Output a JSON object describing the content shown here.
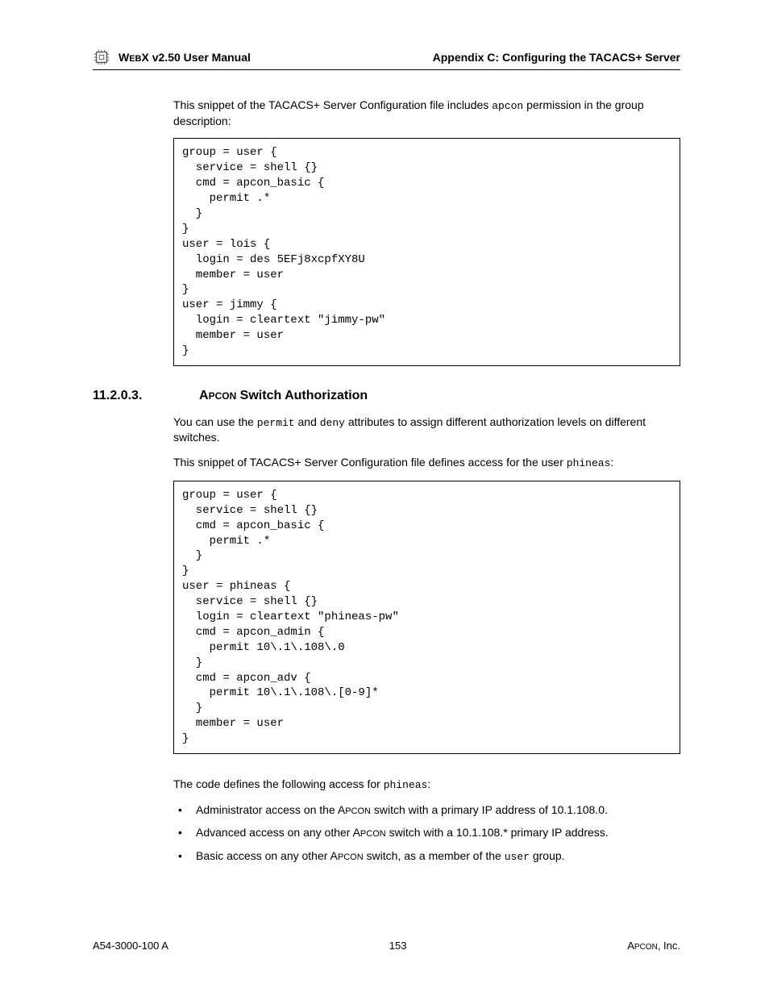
{
  "header": {
    "left_prefix": "W",
    "left_smallcaps": "EB",
    "left_rest": "X v2.50 User Manual",
    "right": "Appendix C: Configuring the TACACS+ Server"
  },
  "intro_para_pre": "This snippet of the TACACS+ Server Configuration file includes ",
  "intro_para_code": "apcon",
  "intro_para_post": " permission in the group description:",
  "code1": "group = user {\n  service = shell {}\n  cmd = apcon_basic {\n    permit .*\n  }\n}\nuser = lois {\n  login = des 5EFj8xcpfXY8U\n  member = user\n}\nuser = jimmy {\n  login = cleartext \"jimmy-pw\"\n  member = user\n}",
  "section": {
    "num": "11.2.0.3.",
    "title_pre": "A",
    "title_sc": "PCON",
    "title_rest": " Switch Authorization"
  },
  "auth_para_1_pre": "You can use the ",
  "auth_para_1_code1": "permit",
  "auth_para_1_mid": " and ",
  "auth_para_1_code2": "deny",
  "auth_para_1_post": " attributes to assign different authorization levels on different switches.",
  "auth_para_2_pre": "This snippet of TACACS+ Server Configuration file defines access for the user ",
  "auth_para_2_code": "phineas",
  "auth_para_2_post": ":",
  "code2": "group = user {\n  service = shell {}\n  cmd = apcon_basic {\n    permit .*\n  }\n}\nuser = phineas {\n  service = shell {}\n  login = cleartext \"phineas-pw\"\n  cmd = apcon_admin {\n    permit 10\\.1\\.108\\.0\n  }\n  cmd = apcon_adv {\n    permit 10\\.1\\.108\\.[0-9]*\n  }\n  member = user\n}",
  "result_para_pre": "The code defines the following access for ",
  "result_para_code": "phineas",
  "result_para_post": ":",
  "bullets": {
    "b1_pre": "Administrator access on the A",
    "b1_sc": "PCON",
    "b1_post": " switch with a primary IP address of 10.1.108.0.",
    "b2_pre": "Advanced access on any other A",
    "b2_sc": "PCON",
    "b2_post": " switch with a 10.1.108.* primary IP address.",
    "b3_pre": "Basic access on any other A",
    "b3_sc": "PCON",
    "b3_mid": " switch, as a member of the ",
    "b3_code": "user",
    "b3_post": " group."
  },
  "footer": {
    "left": "A54-3000-100 A",
    "center": "153",
    "right_pre": "A",
    "right_sc": "PCON",
    "right_post": ", Inc."
  }
}
